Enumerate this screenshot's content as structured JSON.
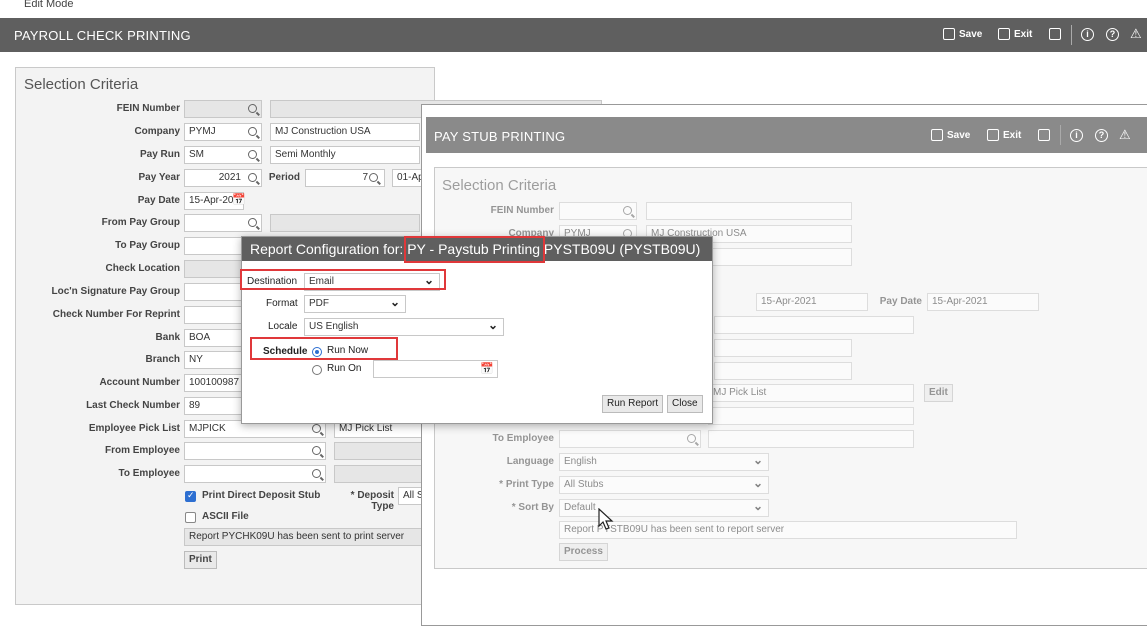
{
  "mode_bar": {
    "label": "Edit Mode"
  },
  "main_window": {
    "title": "PAYROLL CHECK PRINTING",
    "toolbar": {
      "save": "Save",
      "exit": "Exit"
    },
    "section_title": "Selection Criteria",
    "labels": {
      "fein": "FEIN Number",
      "company": "Company",
      "pay_run": "Pay Run",
      "pay_year": "Pay Year",
      "period": "Period",
      "pay_date": "Pay Date",
      "from_pay_group": "From Pay Group",
      "to_pay_group": "To Pay Group",
      "check_location": "Check Location",
      "locn_sig": "Loc'n Signature Pay Group",
      "check_reprint": "Check Number For Reprint",
      "bank": "Bank",
      "branch": "Branch",
      "account": "Account Number",
      "last_check": "Last Check Number",
      "emp_pick": "Employee Pick List",
      "from_emp": "From Employee",
      "to_emp": "To Employee",
      "print_dd": "Print Direct Deposit Stub",
      "deposit_type": "* Deposit Type",
      "ascii": "ASCII File"
    },
    "values": {
      "company_code": "PYMJ",
      "company_name": "MJ Construction USA",
      "pay_run_code": "SM",
      "pay_run_name": "Semi Monthly",
      "pay_year": "2021",
      "period": "7",
      "period_date": "01-Ap",
      "pay_date": "15-Apr-2021",
      "bank": "BOA",
      "branch": "NY",
      "account": "100100987",
      "last_check": "89",
      "emp_pick_code": "MJPICK",
      "emp_pick_name": "MJ Pick List",
      "deposit_type": "All S",
      "status": "Report PYCHK09U has been sent to print server"
    },
    "print_button": "Print"
  },
  "stub_window": {
    "title": "PAY STUB PRINTING",
    "toolbar": {
      "save": "Save",
      "exit": "Exit"
    },
    "section_title": "Selection Criteria",
    "labels": {
      "fein": "FEIN Number",
      "company": "Company",
      "pay_date": "Pay Date",
      "to_employee": "To Employee",
      "language": "Language",
      "print_type": "* Print Type",
      "sort_by": "* Sort By"
    },
    "values": {
      "company_code": "PYMJ",
      "company_name": "MJ Construction USA",
      "date1": "15-Apr-2021",
      "pay_date": "15-Apr-2021",
      "pick_list": "MJ Pick List",
      "language": "English",
      "print_type": "All Stubs",
      "sort_by": "Default",
      "status": "Report PYSTB09U has been sent to report server"
    },
    "edit_button": "Edit",
    "process_button": "Process"
  },
  "dialog": {
    "title_prefix": "Report Configuration for: ",
    "title_highlight": "PY - Paystub Printing",
    "title_suffix": " PYSTB09U (PYSTB09U)",
    "destination_label": "Destination",
    "destination_value": "Email",
    "format_label": "Format",
    "format_value": "PDF",
    "locale_label": "Locale",
    "locale_value": "US English",
    "schedule_label": "Schedule",
    "run_now": "Run Now",
    "run_on": "Run On",
    "run_report_button": "Run Report",
    "close_button": "Close"
  }
}
